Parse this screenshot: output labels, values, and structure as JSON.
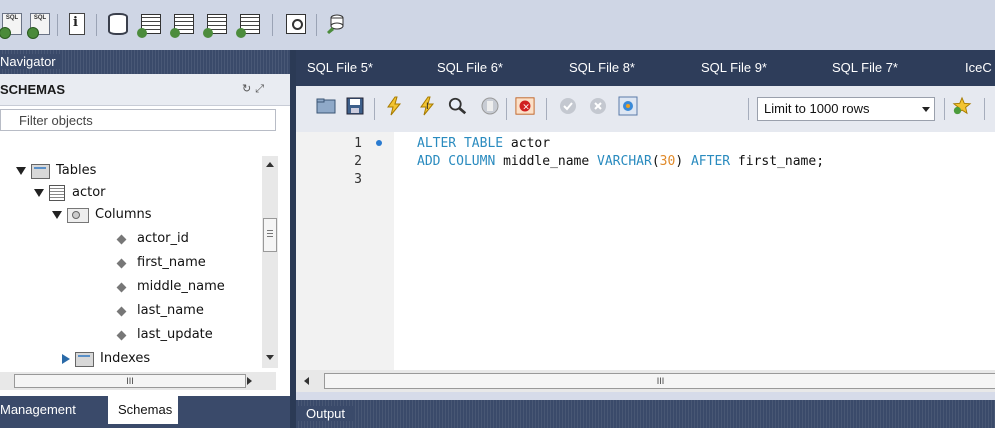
{
  "toolbar": {
    "icons": [
      "new-sql-tab-icon",
      "open-sql-script-icon",
      "inspector-icon",
      "create-schema-icon",
      "create-table-icon",
      "create-view-icon",
      "create-procedure-icon",
      "create-function-icon",
      "search-table-data-icon",
      "reconnect-icon"
    ],
    "sql_badge": "SQL"
  },
  "navigator": {
    "title": "Navigator",
    "schemas_label": "SCHEMAS",
    "filter_placeholder": "Filter objects",
    "tree": {
      "tables": "Tables",
      "actor": "actor",
      "columns": "Columns",
      "column_items": [
        "actor_id",
        "first_name",
        "middle_name",
        "last_name",
        "last_update"
      ],
      "indexes": "Indexes"
    },
    "scroll_grip": "III",
    "tabs": {
      "management": "Management",
      "schemas": "Schemas"
    }
  },
  "editor": {
    "tabs": [
      "SQL File 5*",
      "SQL File 6*",
      "SQL File 8*",
      "SQL File 9*",
      "SQL File 7*",
      "IceC"
    ],
    "limit_select": "Limit to 1000 rows",
    "line_numbers": [
      "1",
      "2",
      "3"
    ],
    "code": {
      "line1_kw": "ALTER TABLE",
      "line1_rest": " actor",
      "line2_kw1": "ADD COLUMN",
      "line2_mid": " middle_name ",
      "line2_type": "VARCHAR",
      "line2_open": "(",
      "line2_num": "30",
      "line2_close": ")",
      "line2_kw2": " AFTER",
      "line2_end": " first_name;"
    },
    "scroll_grip": "III"
  },
  "output": {
    "title": "Output"
  }
}
